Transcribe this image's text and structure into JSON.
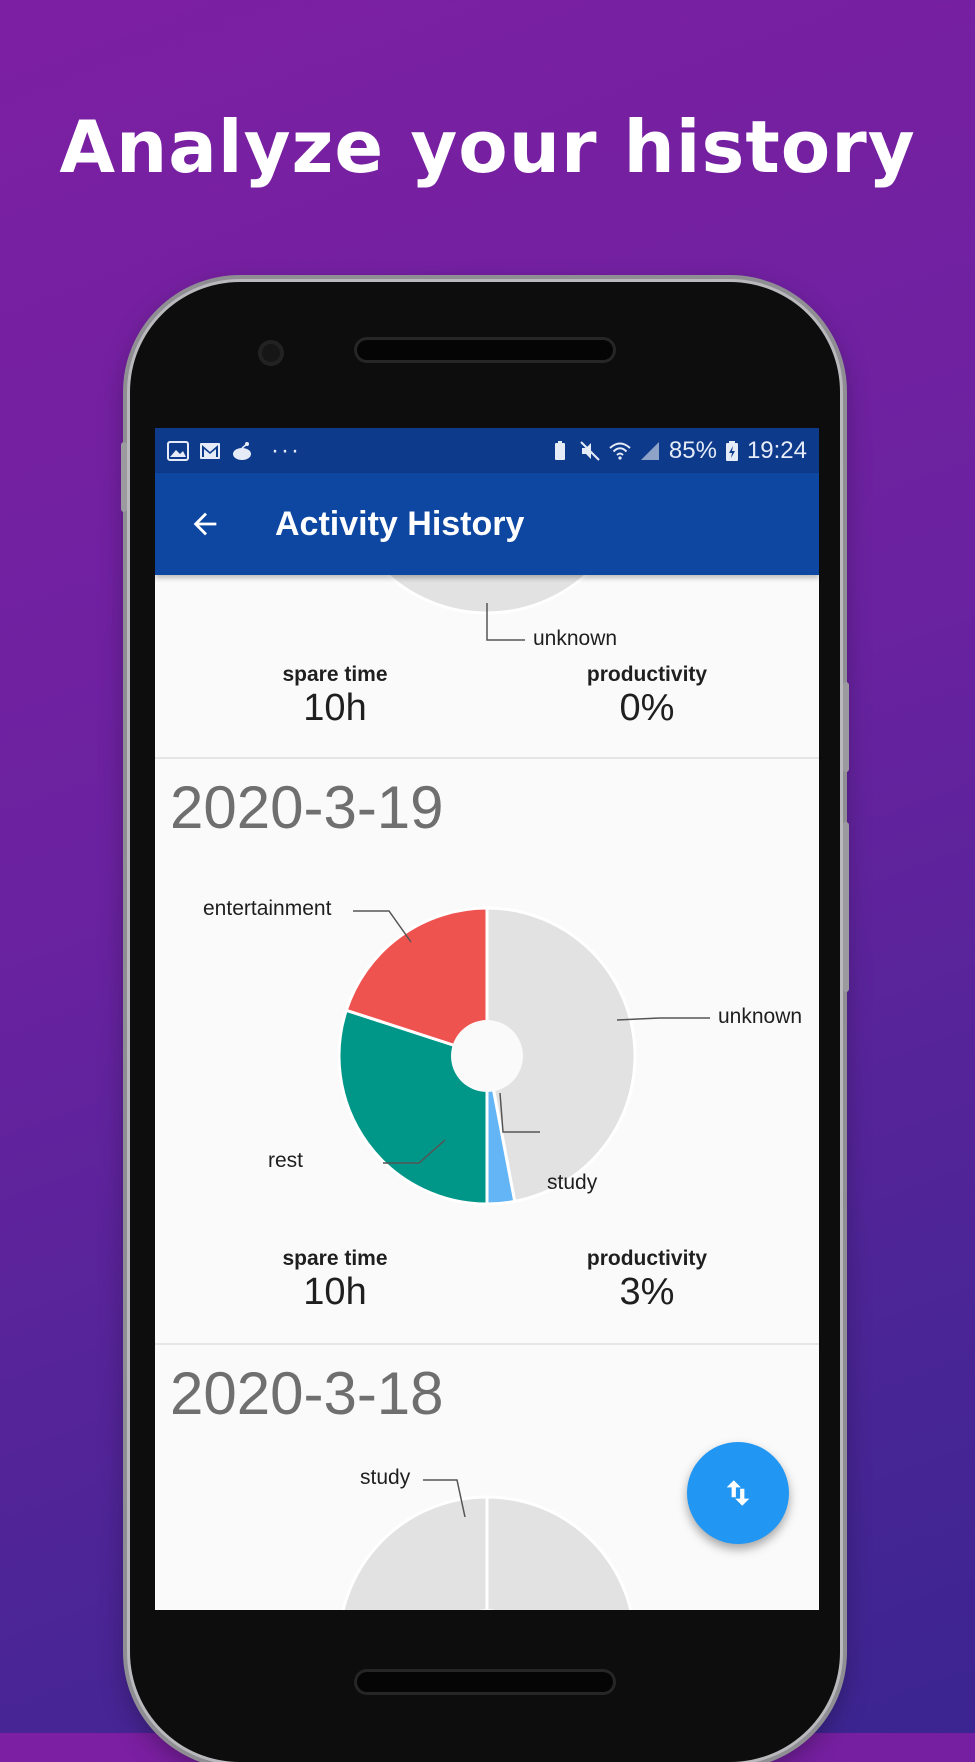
{
  "headline": "Analyze your history",
  "status_bar": {
    "battery": "85%",
    "time": "19:24",
    "left_icons": [
      "image-icon",
      "gmail-icon",
      "reddit-icon",
      "more-dots-icon"
    ],
    "right_icons": [
      "battery-saver-icon",
      "mute-icon",
      "wifi-icon",
      "signal-icon",
      "battery-charging-icon"
    ],
    "more": "···"
  },
  "app_bar": {
    "title": "Activity History",
    "back_icon": "arrow-back-icon"
  },
  "colors": {
    "unknown": "#e2e2e2",
    "entertainment": "#ef5350",
    "rest": "#009688",
    "study": "#64b5f6",
    "app_bar": "#0e47a1",
    "status_bar": "#0e3a8c",
    "fab": "#2196f3"
  },
  "days": [
    {
      "date": "",
      "pie_labels": [
        "unknown"
      ],
      "spare_time_label": "spare time",
      "spare_time": "10h",
      "productivity_label": "productivity",
      "productivity": "0%"
    },
    {
      "date": "2020-3-19",
      "pie_labels": [
        "entertainment",
        "unknown",
        "rest",
        "study"
      ],
      "spare_time_label": "spare time",
      "spare_time": "10h",
      "productivity_label": "productivity",
      "productivity": "3%"
    },
    {
      "date": "2020-3-18",
      "pie_labels": [
        "study"
      ]
    }
  ],
  "chart_data": [
    {
      "type": "pie",
      "title": "",
      "categories": [
        "unknown"
      ],
      "values": [
        100
      ]
    },
    {
      "type": "pie",
      "title": "2020-3-19",
      "categories": [
        "unknown",
        "study",
        "rest",
        "entertainment"
      ],
      "values": [
        47,
        3,
        30,
        20
      ]
    },
    {
      "type": "pie",
      "title": "2020-3-18",
      "categories": [
        "unknown",
        "study",
        "unknown"
      ],
      "values": [
        48,
        3,
        49
      ]
    }
  ],
  "fab": {
    "icon": "swap-vertical-icon"
  }
}
